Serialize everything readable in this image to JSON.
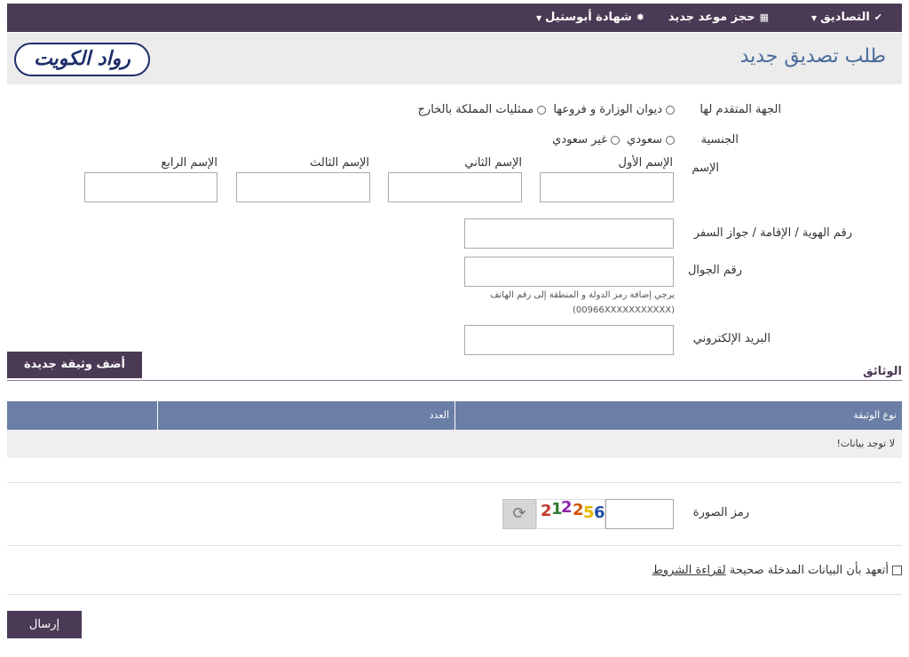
{
  "nav": {
    "attestations": "التصاديق",
    "new_appointment": "حجز موعد جديد",
    "apostille": "شهادة أبوستيل"
  },
  "header": {
    "title": "طلب تصديق جديد",
    "logo_text": "رواد الكويت"
  },
  "form": {
    "applicant_entity_label": "الجهة المتقدم لها",
    "applicant_entity_options": [
      "ديوان الوزارة و فروعها",
      "ممثليات المملكة بالخارج"
    ],
    "nationality_label": "الجنسية",
    "nationality_options": [
      "سعودي",
      "غير سعودي"
    ],
    "name_label": "الإسم",
    "name_parts": [
      "الإسم الأول",
      "الإسم الثاني",
      "الإسم الثالث",
      "الإسم الرابع"
    ],
    "id_label": "رقم الهوية / الإقامة / جواز السفر",
    "mobile_label": "رقم الجوال",
    "mobile_hint_line1": "يرجي إضافة رمز الدولة و المنطقة إلى رقم الهاتف",
    "mobile_hint_line2": "(00966XXXXXXXXXXX)",
    "email_label": "البريد الإلكتروني"
  },
  "documents": {
    "add_button": "أضف وثيقة جديدة",
    "section_title": "الوثائق",
    "columns": [
      "نوع الوثيقة",
      "العدد"
    ],
    "empty_text": "لا توجد بيانات!"
  },
  "captcha": {
    "label": "رمز الصورة",
    "digits": [
      "2",
      "1",
      "2",
      "2",
      "5",
      "6"
    ],
    "digit_colors": [
      "#c0392b",
      "#2e7d32",
      "#8e24aa",
      "#d35400",
      "#e6b800",
      "#1f4fa8"
    ]
  },
  "terms": {
    "pledge_text": "أتعهد بأن البيانات المدخلة صحيحة",
    "link_text": "لقراءة الشروط"
  },
  "submit_label": "إرسال",
  "icons": {
    "check_circle": "check-circle-icon",
    "calendar": "calendar-icon",
    "certificate": "certificate-icon",
    "refresh": "refresh-icon"
  }
}
